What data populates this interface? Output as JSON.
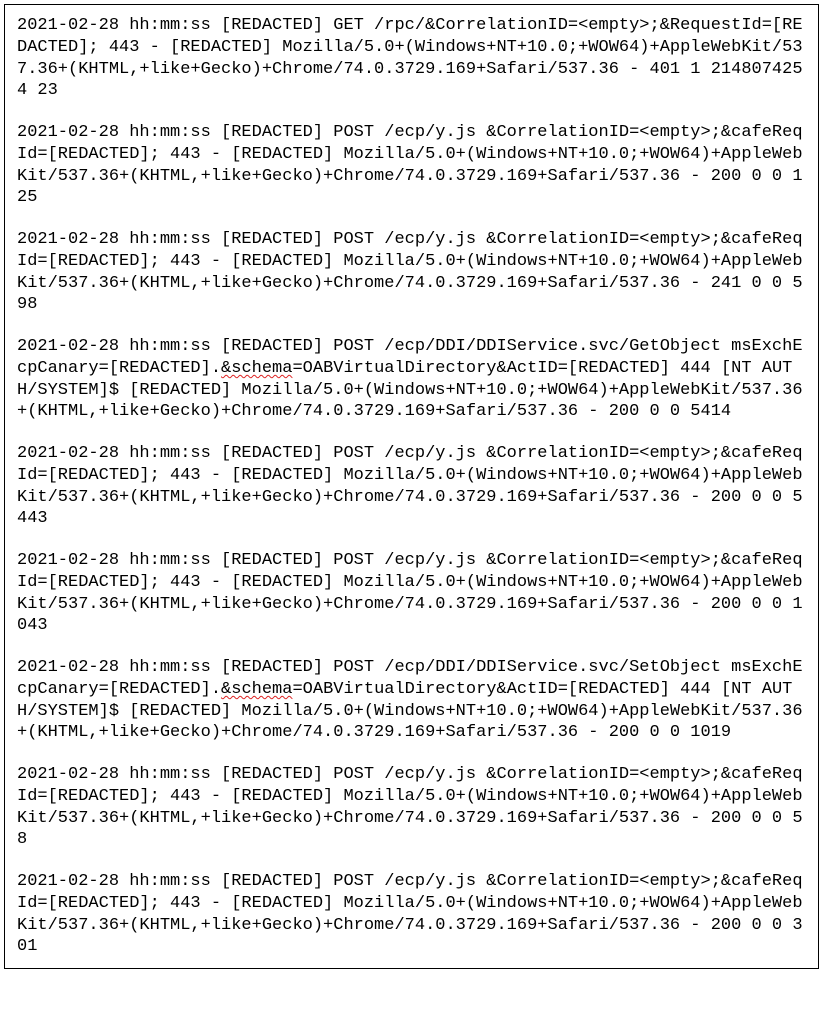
{
  "entries": [
    {
      "head": "2021-02-28 hh:mm:ss [REDACTED] GET /rpc/&CorrelationID=<empty>;&RequestId=[REDACTED]; 443 - [REDACTED] Mozilla/5.0+(Windows+NT+10.0;+WOW64)+AppleWebKit/537.36+(KHTML,+like+Gecko)+Chrome/74.0.3729.169+Safari/537.36 - 401 1 2148074254 23",
      "err": "",
      "tail": ""
    },
    {
      "head": "2021-02-28 hh:mm:ss [REDACTED] POST /ecp/y.js &CorrelationID=<empty>;&cafeReqId=[REDACTED]; 443 - [REDACTED] Mozilla/5.0+(Windows+NT+10.0;+WOW64)+AppleWebKit/537.36+(KHTML,+like+Gecko)+Chrome/74.0.3729.169+Safari/537.36 - 200 0 0 125",
      "err": "",
      "tail": ""
    },
    {
      "head": "2021-02-28 hh:mm:ss [REDACTED] POST /ecp/y.js &CorrelationID=<empty>;&cafeReqId=[REDACTED]; 443 - [REDACTED] Mozilla/5.0+(Windows+NT+10.0;+WOW64)+AppleWebKit/537.36+(KHTML,+like+Gecko)+Chrome/74.0.3729.169+Safari/537.36 - 241 0 0 598",
      "err": "",
      "tail": ""
    },
    {
      "head": "2021-02-28 hh:mm:ss [REDACTED] POST /ecp/DDI/DDIService.svc/GetObject msExchEcpCanary=[REDACTED].",
      "err": "&schema",
      "tail": "=OABVirtualDirectory&ActID=[REDACTED] 444 [NT AUTH/SYSTEM]$ [REDACTED] Mozilla/5.0+(Windows+NT+10.0;+WOW64)+AppleWebKit/537.36+(KHTML,+like+Gecko)+Chrome/74.0.3729.169+Safari/537.36 - 200 0 0 5414"
    },
    {
      "head": "2021-02-28 hh:mm:ss [REDACTED] POST /ecp/y.js &CorrelationID=<empty>;&cafeReqId=[REDACTED]; 443 - [REDACTED] Mozilla/5.0+(Windows+NT+10.0;+WOW64)+AppleWebKit/537.36+(KHTML,+like+Gecko)+Chrome/74.0.3729.169+Safari/537.36 - 200 0 0 5443",
      "err": "",
      "tail": ""
    },
    {
      "head": "2021-02-28 hh:mm:ss [REDACTED] POST /ecp/y.js &CorrelationID=<empty>;&cafeReqId=[REDACTED]; 443 - [REDACTED] Mozilla/5.0+(Windows+NT+10.0;+WOW64)+AppleWebKit/537.36+(KHTML,+like+Gecko)+Chrome/74.0.3729.169+Safari/537.36 - 200 0 0 1043",
      "err": "",
      "tail": ""
    },
    {
      "head": "2021-02-28 hh:mm:ss [REDACTED] POST /ecp/DDI/DDIService.svc/SetObject msExchEcpCanary=[REDACTED].",
      "err": "&schema",
      "tail": "=OABVirtualDirectory&ActID=[REDACTED] 444 [NT AUTH/SYSTEM]$ [REDACTED] Mozilla/5.0+(Windows+NT+10.0;+WOW64)+AppleWebKit/537.36+(KHTML,+like+Gecko)+Chrome/74.0.3729.169+Safari/537.36 - 200 0 0 1019"
    },
    {
      "head": "2021-02-28 hh:mm:ss [REDACTED] POST /ecp/y.js &CorrelationID=<empty>;&cafeReqId=[REDACTED]; 443 - [REDACTED] Mozilla/5.0+(Windows+NT+10.0;+WOW64)+AppleWebKit/537.36+(KHTML,+like+Gecko)+Chrome/74.0.3729.169+Safari/537.36 - 200 0 0 58",
      "err": "",
      "tail": ""
    },
    {
      "head": "2021-02-28 hh:mm:ss [REDACTED] POST /ecp/y.js &CorrelationID=<empty>;&cafeReqId=[REDACTED]; 443 - [REDACTED] Mozilla/5.0+(Windows+NT+10.0;+WOW64)+AppleWebKit/537.36+(KHTML,+like+Gecko)+Chrome/74.0.3729.169+Safari/537.36 - 200 0 0 301",
      "err": "",
      "tail": ""
    }
  ]
}
